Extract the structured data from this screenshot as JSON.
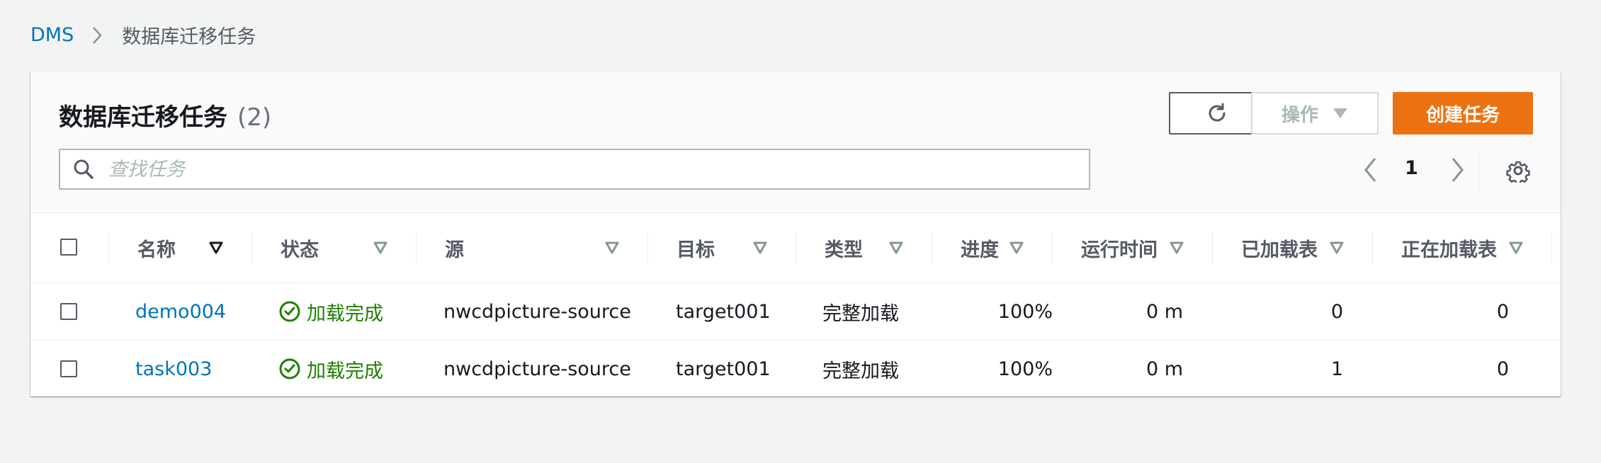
{
  "breadcrumb": {
    "root": "DMS",
    "current": "数据库迁移任务"
  },
  "panel": {
    "title": "数据库迁移任务",
    "count": "(2)",
    "actions_label": "操作",
    "create_label": "创建任务",
    "search_placeholder": "查找任务",
    "page": "1"
  },
  "columns": [
    "名称",
    "状态",
    "源",
    "目标",
    "类型",
    "进度",
    "运行时间",
    "已加载表",
    "正在加载表"
  ],
  "rows": [
    {
      "name": "demo004",
      "status": "加载完成",
      "source": "nwcdpicture-source",
      "target": "target001",
      "type": "完整加载",
      "progress": "100%",
      "elapsed": "0 m",
      "loaded": "0",
      "loading": "0"
    },
    {
      "name": "task003",
      "status": "加载完成",
      "source": "nwcdpicture-source",
      "target": "target001",
      "type": "完整加载",
      "progress": "100%",
      "elapsed": "0 m",
      "loaded": "1",
      "loading": "0"
    }
  ],
  "colors": {
    "link": "#0073bb",
    "success": "#1d8102",
    "primary": "#ec7211"
  }
}
